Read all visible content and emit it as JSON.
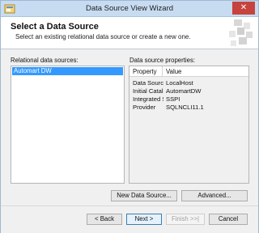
{
  "window": {
    "title": "Data Source View Wizard",
    "close_glyph": "✕"
  },
  "header": {
    "title": "Select a Data Source",
    "subtitle": "Select an existing relational data source or create a new one."
  },
  "relational": {
    "label": "Relational data sources:",
    "items": [
      "Automart DW"
    ]
  },
  "properties": {
    "label": "Data source properties:",
    "columns": [
      "Property",
      "Value"
    ],
    "rows": [
      {
        "property": "Data Source",
        "value": "LocalHost"
      },
      {
        "property": "Initial Catalog",
        "value": "AutomartDW"
      },
      {
        "property": "Integrated Sec...",
        "value": "SSPI"
      },
      {
        "property": "Provider",
        "value": "SQLNCLI11.1"
      }
    ]
  },
  "buttons": {
    "new_data_source": "New Data Source...",
    "advanced": "Advanced...",
    "back": "< Back",
    "next": "Next >",
    "finish": "Finish >>|",
    "cancel": "Cancel"
  },
  "colors": {
    "selection": "#3399ff",
    "titlebar": "#c7dcf1",
    "close": "#c7433d"
  }
}
